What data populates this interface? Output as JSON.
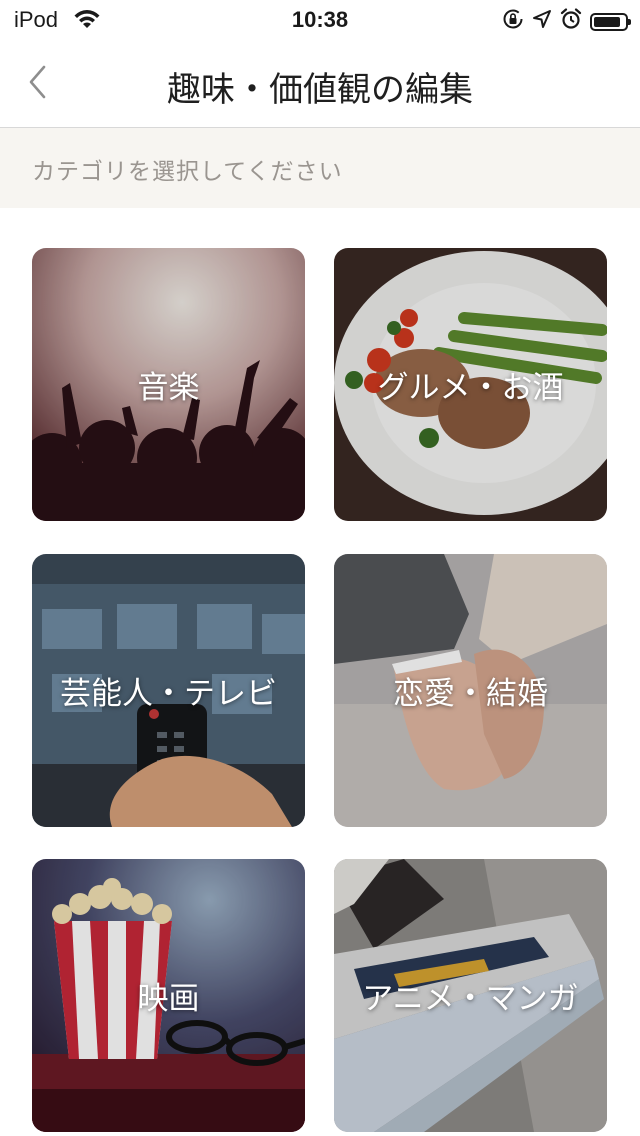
{
  "status_bar": {
    "carrier": "iPod",
    "time": "10:38",
    "battery_level": 0.85,
    "icons": [
      "wifi-icon",
      "orientation-lock-icon",
      "location-arrow-icon",
      "alarm-icon",
      "battery-icon"
    ]
  },
  "nav": {
    "title": "趣味・価値観の編集",
    "back_icon": "chevron-left-icon"
  },
  "subheader": {
    "text": "カテゴリを選択してください"
  },
  "categories": [
    {
      "label": "音楽",
      "image": "concert-crowd"
    },
    {
      "label": "グルメ・お酒",
      "image": "steak-asparagus-plate"
    },
    {
      "label": "芸能人・テレビ",
      "image": "tv-remote"
    },
    {
      "label": "恋愛・結婚",
      "image": "holding-hands"
    },
    {
      "label": "映画",
      "image": "popcorn-glasses"
    },
    {
      "label": "アニメ・マンガ",
      "image": "manga-pages"
    }
  ],
  "colors": {
    "subheader_bg": "#f7f5f1",
    "subheader_text": "#9a9590",
    "divider": "#d8d8d8"
  }
}
